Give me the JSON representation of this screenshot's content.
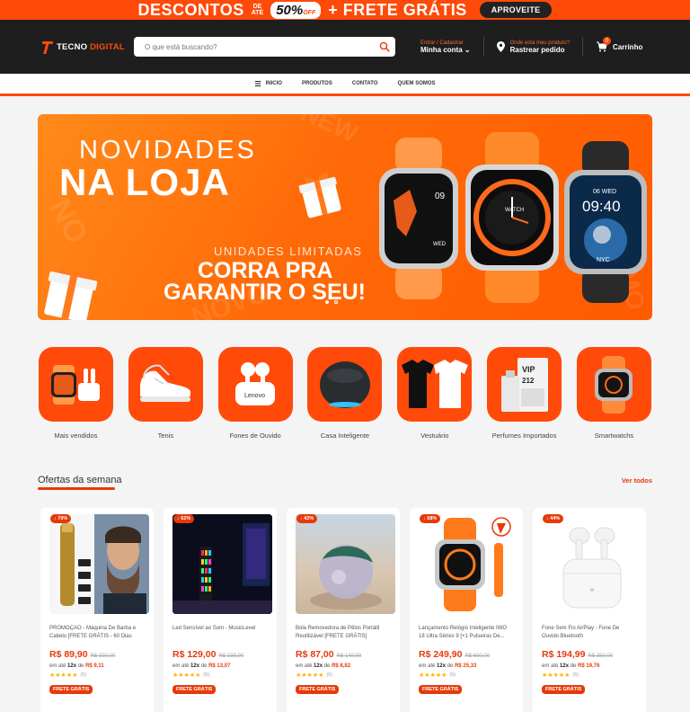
{
  "promo": {
    "text": "DESCONTOS",
    "de": "DE",
    "ate": "ATÉ",
    "pct": "50%",
    "off": "OFF",
    "plus": "+ FRETE GRÁTIS",
    "button": "APROVEITE"
  },
  "header": {
    "logo_a": "TECNO",
    "logo_b": "DIGITAL",
    "search_placeholder": "O que está buscando?",
    "account_small": "Entrar / Cadastrar",
    "account_big": "Minha conta",
    "track_small": "Onde está meu produto?",
    "track_big": "Rastrear pedido",
    "cart_label": "Carrinho",
    "cart_count": "0"
  },
  "nav": {
    "items": [
      "INICIO",
      "PRODUTOS",
      "CONTATO",
      "QUEM SOMOS"
    ]
  },
  "banner": {
    "line1": "NOVIDADES",
    "line2": "NA LOJA",
    "line3": "UNIDADES LIMITADAS",
    "line4": "CORRA PRA",
    "line5": "GARANTIR O SEU!",
    "watch_time": "09:40",
    "watch_date": "06 WED",
    "watch_city": "NYC",
    "colors": {
      "accent": "#ff4a0a"
    }
  },
  "categories": [
    {
      "label": "Mais vendidos",
      "icon": "watch-earbuds-icon"
    },
    {
      "label": "Tenis",
      "icon": "sneaker-icon"
    },
    {
      "label": "Fones de Ouvido",
      "icon": "earbuds-icon",
      "brand": "Lenovo"
    },
    {
      "label": "Casa Inteligente",
      "icon": "smart-speaker-icon"
    },
    {
      "label": "Vestuário",
      "icon": "tshirt-icon"
    },
    {
      "label": "Perfumes Importados",
      "icon": "perfume-icon",
      "brand": "VIP 212"
    },
    {
      "label": "Smartwatchs",
      "icon": "smartwatch-icon"
    }
  ],
  "offers": {
    "title": "Ofertas da semana",
    "see_all": "Ver todos"
  },
  "products": [
    {
      "discount": "↓ 70%",
      "title": "PROMOÇÃO - Máquina De Barba e Cabelo [FRETE GRÁTIS - 60 Dias De...",
      "price": "R$ 89,90",
      "old": "R$ 300,00",
      "inst_a": "em até",
      "inst_b": "12x",
      "inst_c": "de",
      "inst_d": "R$ 9,11",
      "reviews": "(5)",
      "rating": 5,
      "ship": "FRETE GRÁTIS",
      "icon": "trimmer-icon"
    },
    {
      "discount": "↓ 62%",
      "title": "Led Sensível ao Som - MusicLevel",
      "price": "R$ 129,00",
      "old": "R$ 339,90",
      "inst_a": "em até",
      "inst_b": "12x",
      "inst_c": "de",
      "inst_d": "R$ 13,07",
      "reviews": "(5)",
      "rating": 5,
      "ship": "FRETE GRÁTIS",
      "icon": "led-bar-icon"
    },
    {
      "discount": "↓ 42%",
      "title": "Bola Removedora de Pêlos Portátil Reutilizável [FRETE GRÁTIS]",
      "price": "R$ 87,00",
      "old": "R$ 149,90",
      "inst_a": "em até",
      "inst_b": "12x",
      "inst_c": "de",
      "inst_d": "R$ 8,82",
      "reviews": "(5)",
      "rating": 5,
      "ship": "FRETE GRÁTIS",
      "icon": "lint-ball-icon"
    },
    {
      "discount": "↓ 58%",
      "title": "Lançamento Relógio Inteligente IWO 18 Ultra Séries 9 [+1 Pulseiras De...",
      "price": "R$ 249,90",
      "old": "R$ 600,00",
      "inst_a": "em até",
      "inst_b": "12x",
      "inst_c": "de",
      "inst_d": "R$ 25,33",
      "reviews": "(5)",
      "rating": 5,
      "ship": "FRETE GRÁTIS",
      "icon": "orange-watch-icon"
    },
    {
      "discount": "↓ 44%",
      "title": "Fone Sem Fio AirPlay - Fone De Ouvido Bluetooth",
      "price": "R$ 194,99",
      "old": "R$ 350,00",
      "inst_a": "em até",
      "inst_b": "12x",
      "inst_c": "de",
      "inst_d": "R$ 19,76",
      "reviews": "(5)",
      "rating": 5,
      "ship": "FRETE GRÁTIS",
      "icon": "airpods-icon"
    }
  ]
}
